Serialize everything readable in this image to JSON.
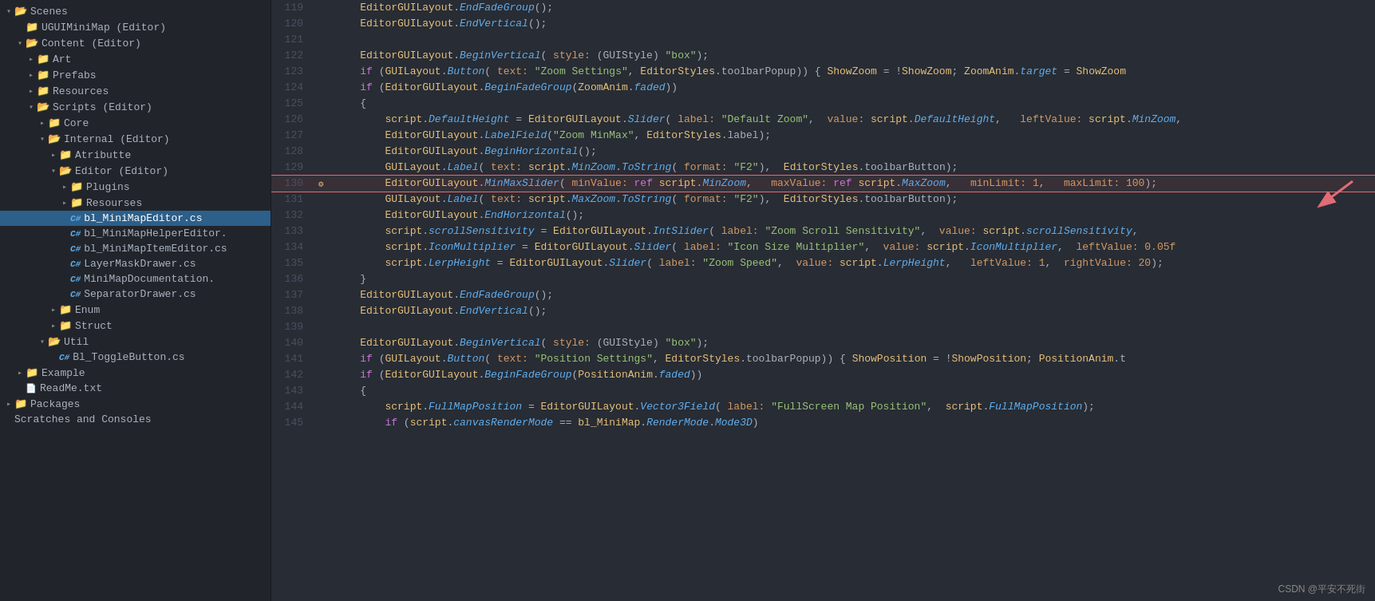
{
  "sidebar": {
    "items": [
      {
        "id": "scenes",
        "label": "Scenes",
        "indent": 0,
        "type": "folder",
        "state": "open",
        "active": false
      },
      {
        "id": "ugui-minimap",
        "label": "UGUIMiniMap (Editor)",
        "indent": 1,
        "type": "folder",
        "state": "none",
        "active": false
      },
      {
        "id": "content",
        "label": "Content (Editor)",
        "indent": 1,
        "type": "folder",
        "state": "open",
        "active": false
      },
      {
        "id": "art",
        "label": "Art",
        "indent": 2,
        "type": "folder",
        "state": "closed",
        "active": false
      },
      {
        "id": "prefabs",
        "label": "Prefabs",
        "indent": 2,
        "type": "folder",
        "state": "closed",
        "active": false
      },
      {
        "id": "resources",
        "label": "Resources",
        "indent": 2,
        "type": "folder",
        "state": "closed",
        "active": false
      },
      {
        "id": "scripts",
        "label": "Scripts (Editor)",
        "indent": 2,
        "type": "folder",
        "state": "open",
        "active": false
      },
      {
        "id": "core",
        "label": "Core",
        "indent": 3,
        "type": "folder",
        "state": "closed",
        "active": false
      },
      {
        "id": "internal",
        "label": "Internal (Editor)",
        "indent": 3,
        "type": "folder",
        "state": "open",
        "active": false
      },
      {
        "id": "atributte",
        "label": "Atributte",
        "indent": 4,
        "type": "folder",
        "state": "closed",
        "active": false
      },
      {
        "id": "editor",
        "label": "Editor (Editor)",
        "indent": 4,
        "type": "folder",
        "state": "open",
        "active": false
      },
      {
        "id": "plugins",
        "label": "Plugins",
        "indent": 5,
        "type": "folder",
        "state": "closed",
        "active": false
      },
      {
        "id": "resourses",
        "label": "Resourses",
        "indent": 5,
        "type": "folder",
        "state": "closed",
        "active": false
      },
      {
        "id": "bl-minimapeditor",
        "label": "bl_MiniMapEditor.cs",
        "indent": 5,
        "type": "cs",
        "state": "none",
        "active": true
      },
      {
        "id": "bl-minimaphelper",
        "label": "bl_MiniMapHelperEditor.",
        "indent": 5,
        "type": "cs",
        "state": "none",
        "active": false
      },
      {
        "id": "bl-minimapitem",
        "label": "bl_MiniMapItemEditor.cs",
        "indent": 5,
        "type": "cs",
        "state": "none",
        "active": false
      },
      {
        "id": "layermask",
        "label": "LayerMaskDrawer.cs",
        "indent": 5,
        "type": "cs",
        "state": "none",
        "active": false
      },
      {
        "id": "minimapdoc",
        "label": "MiniMapDocumentation.",
        "indent": 5,
        "type": "cs",
        "state": "none",
        "active": false
      },
      {
        "id": "separator",
        "label": "SeparatorDrawer.cs",
        "indent": 5,
        "type": "cs",
        "state": "none",
        "active": false
      },
      {
        "id": "enum",
        "label": "Enum",
        "indent": 4,
        "type": "folder",
        "state": "closed",
        "active": false
      },
      {
        "id": "struct",
        "label": "Struct",
        "indent": 4,
        "type": "folder",
        "state": "closed",
        "active": false
      },
      {
        "id": "util",
        "label": "Util",
        "indent": 3,
        "type": "folder",
        "state": "open",
        "active": false
      },
      {
        "id": "bl-togglebutton",
        "label": "Bl_ToggleButton.cs",
        "indent": 4,
        "type": "cs",
        "state": "none",
        "active": false
      },
      {
        "id": "example",
        "label": "Example",
        "indent": 1,
        "type": "folder",
        "state": "closed",
        "active": false
      },
      {
        "id": "readme",
        "label": "ReadMe.txt",
        "indent": 1,
        "type": "txt",
        "state": "none",
        "active": false
      },
      {
        "id": "packages",
        "label": "Packages",
        "indent": 0,
        "type": "folder",
        "state": "closed",
        "active": false
      },
      {
        "id": "scratches",
        "label": "Scratches and Consoles",
        "indent": 0,
        "type": "none",
        "state": "none",
        "active": false
      }
    ]
  },
  "code": {
    "lines": [
      {
        "num": 119,
        "gutter": "",
        "content": "    EditorGUILayout.EndFadeGroup();"
      },
      {
        "num": 120,
        "gutter": "",
        "content": "    EditorGUILayout.EndVertical();"
      },
      {
        "num": 121,
        "gutter": "",
        "content": ""
      },
      {
        "num": 122,
        "gutter": "",
        "content": "    EditorGUILayout.BeginVertical( style: (GUIStyle) \"box\");"
      },
      {
        "num": 123,
        "gutter": "",
        "content": "    if (GUILayout.Button( text: \"Zoom Settings\", EditorStyles.toolbarPopup)) { ShowZoom = !ShowZoom; ZoomAnim.target = ShowZoom"
      },
      {
        "num": 124,
        "gutter": "",
        "content": "    if (EditorGUILayout.BeginFadeGroup(ZoomAnim.faded))"
      },
      {
        "num": 125,
        "gutter": "",
        "content": "    {"
      },
      {
        "num": 126,
        "gutter": "",
        "content": "        script.DefaultHeight = EditorGUILayout.Slider( label: \"Default Zoom\",  value: script.DefaultHeight,   leftValue: script.MinZoom,"
      },
      {
        "num": 127,
        "gutter": "",
        "content": "        EditorGUILayout.LabelField(\"Zoom MinMax\", EditorStyles.label);"
      },
      {
        "num": 128,
        "gutter": "",
        "content": "        EditorGUILayout.BeginHorizontal();"
      },
      {
        "num": 129,
        "gutter": "",
        "content": "        GUILayout.Label( text: script.MinZoom.ToString( format: \"F2\"),  EditorStyles.toolbarButton);"
      },
      {
        "num": 130,
        "gutter": "⚙",
        "content": "        EditorGUILayout.MinMaxSlider( minValue: ref script.MinZoom,   maxValue: ref script.MaxZoom,   minLimit: 1,   maxLimit: 100);",
        "highlighted": true
      },
      {
        "num": 131,
        "gutter": "",
        "content": "        GUILayout.Label( text: script.MaxZoom.ToString( format: \"F2\"),  EditorStyles.toolbarButton);"
      },
      {
        "num": 132,
        "gutter": "",
        "content": "        EditorGUILayout.EndHorizontal();"
      },
      {
        "num": 133,
        "gutter": "",
        "content": "        script.scrollSensitivity = EditorGUILayout.IntSlider( label: \"Zoom Scroll Sensitivity\",  value: script.scrollSensitivity,"
      },
      {
        "num": 134,
        "gutter": "",
        "content": "        script.IconMultiplier = EditorGUILayout.Slider( label: \"Icon Size Multiplier\",  value: script.IconMultiplier,  leftValue: 0.05f"
      },
      {
        "num": 135,
        "gutter": "",
        "content": "        script.LerpHeight = EditorGUILayout.Slider( label: \"Zoom Speed\",  value: script.LerpHeight,   leftValue: 1,  rightValue: 20);"
      },
      {
        "num": 136,
        "gutter": "",
        "content": "    }"
      },
      {
        "num": 137,
        "gutter": "",
        "content": "    EditorGUILayout.EndFadeGroup();"
      },
      {
        "num": 138,
        "gutter": "",
        "content": "    EditorGUILayout.EndVertical();"
      },
      {
        "num": 139,
        "gutter": "",
        "content": ""
      },
      {
        "num": 140,
        "gutter": "",
        "content": "    EditorGUILayout.BeginVertical( style: (GUIStyle) \"box\");"
      },
      {
        "num": 141,
        "gutter": "",
        "content": "    if (GUILayout.Button( text: \"Position Settings\", EditorStyles.toolbarPopup)) { ShowPosition = !ShowPosition; PositionAnim.t"
      },
      {
        "num": 142,
        "gutter": "",
        "content": "    if (EditorGUILayout.BeginFadeGroup(PositionAnim.faded))"
      },
      {
        "num": 143,
        "gutter": "",
        "content": "    {"
      },
      {
        "num": 144,
        "gutter": "",
        "content": "        script.FullMapPosition = EditorGUILayout.Vector3Field( label: \"FullScreen Map Position\",  script.FullMapPosition);"
      },
      {
        "num": 145,
        "gutter": "",
        "content": "        if (script.canvasRenderMode == bl_MiniMap.RenderMode.Mode3D)"
      }
    ]
  },
  "watermark": "CSDN @平安不死街"
}
